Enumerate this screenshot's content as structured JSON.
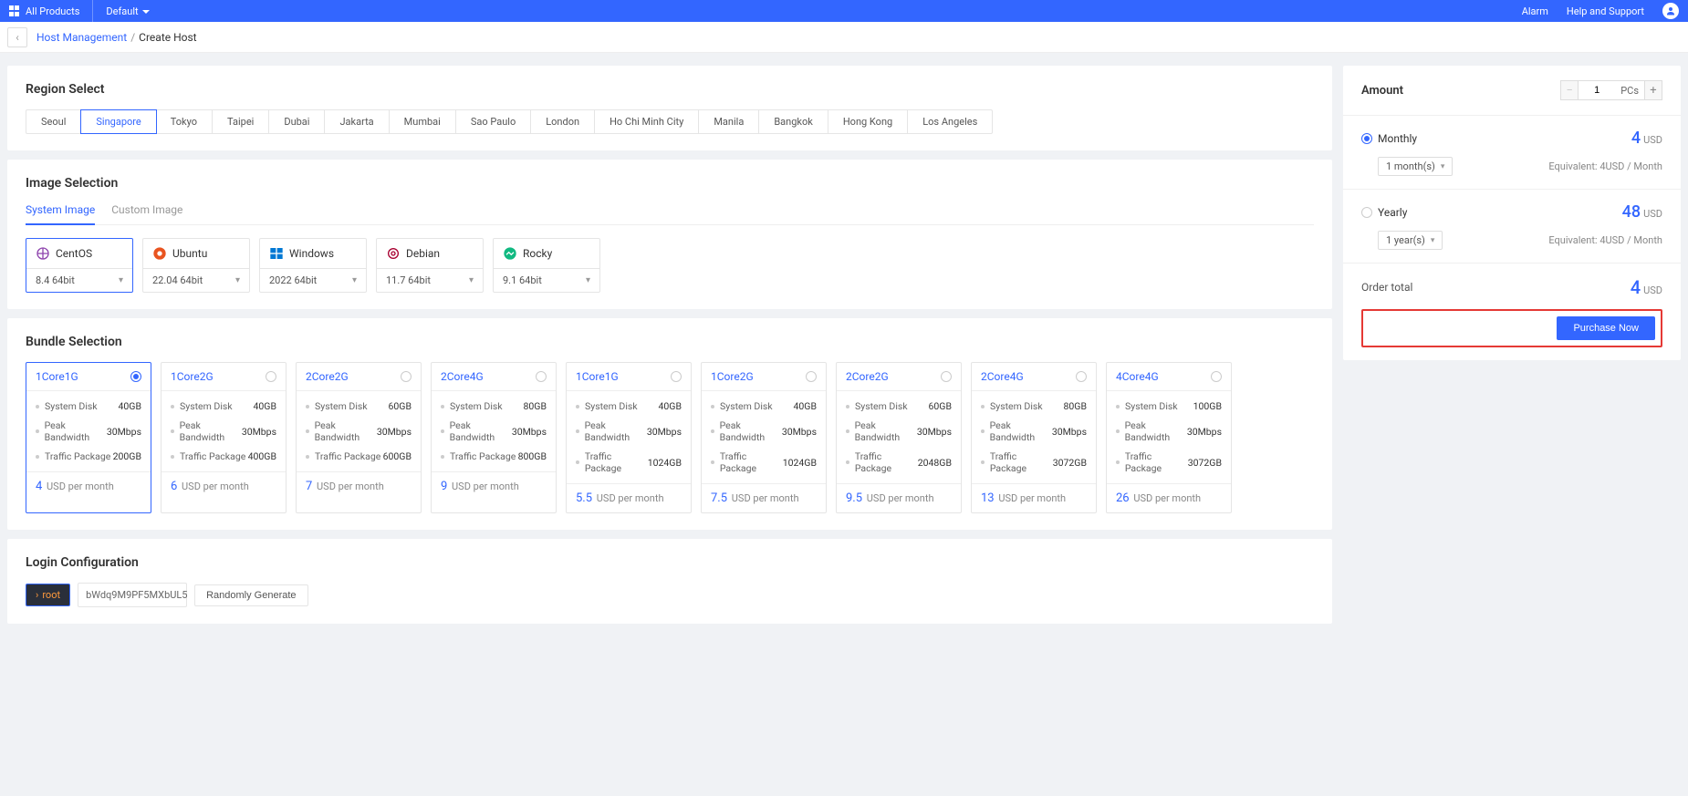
{
  "header": {
    "all_products": "All Products",
    "tenant": "Default",
    "alarm": "Alarm",
    "help": "Help and Support"
  },
  "breadcrumb": {
    "parent": "Host Management",
    "current": "Create Host"
  },
  "region": {
    "title": "Region Select",
    "tabs": [
      "Seoul",
      "Singapore",
      "Tokyo",
      "Taipei",
      "Dubai",
      "Jakarta",
      "Mumbai",
      "Sao Paulo",
      "London",
      "Ho Chi Minh City",
      "Manila",
      "Bangkok",
      "Hong Kong",
      "Los Angeles"
    ],
    "active_index": 1
  },
  "image": {
    "title": "Image Selection",
    "tab_system": "System Image",
    "tab_custom": "Custom Image",
    "os": [
      {
        "name": "CentOS",
        "version": "8.4 64bit",
        "color": "#8e44ad"
      },
      {
        "name": "Ubuntu",
        "version": "22.04 64bit",
        "color": "#e95420"
      },
      {
        "name": "Windows",
        "version": "2022 64bit",
        "color": "#0078d4"
      },
      {
        "name": "Debian",
        "version": "11.7 64bit",
        "color": "#a80030"
      },
      {
        "name": "Rocky",
        "version": "9.1 64bit",
        "color": "#10b981"
      }
    ],
    "active_os": 0
  },
  "bundle": {
    "title": "Bundle Selection",
    "spec_labels": {
      "disk": "System Disk",
      "bw": "Peak Bandwidth",
      "traffic": "Traffic Package"
    },
    "price_suffix": "USD per month",
    "items": [
      {
        "name": "1Core1G",
        "disk": "40GB",
        "bw": "30Mbps",
        "traffic": "200GB",
        "price": "4"
      },
      {
        "name": "1Core2G",
        "disk": "40GB",
        "bw": "30Mbps",
        "traffic": "400GB",
        "price": "6"
      },
      {
        "name": "2Core2G",
        "disk": "60GB",
        "bw": "30Mbps",
        "traffic": "600GB",
        "price": "7"
      },
      {
        "name": "2Core4G",
        "disk": "80GB",
        "bw": "30Mbps",
        "traffic": "800GB",
        "price": "9"
      },
      {
        "name": "1Core1G",
        "disk": "40GB",
        "bw": "30Mbps",
        "traffic": "1024GB",
        "price": "5.5"
      },
      {
        "name": "1Core2G",
        "disk": "40GB",
        "bw": "30Mbps",
        "traffic": "1024GB",
        "price": "7.5"
      },
      {
        "name": "2Core2G",
        "disk": "60GB",
        "bw": "30Mbps",
        "traffic": "2048GB",
        "price": "9.5"
      },
      {
        "name": "2Core4G",
        "disk": "80GB",
        "bw": "30Mbps",
        "traffic": "3072GB",
        "price": "13"
      },
      {
        "name": "4Core4G",
        "disk": "100GB",
        "bw": "30Mbps",
        "traffic": "3072GB",
        "price": "26"
      }
    ],
    "active_index": 0
  },
  "login": {
    "title": "Login Configuration",
    "user": "root",
    "password": "bWdq9M9PF5MXbUL5",
    "random_btn": "Randomly Generate"
  },
  "side": {
    "amount_label": "Amount",
    "amount_value": "1",
    "amount_unit": "PCs",
    "monthly": {
      "label": "Monthly",
      "price": "4",
      "unit": "USD",
      "select": "1 month(s)",
      "equiv": "Equivalent: 4USD / Month"
    },
    "yearly": {
      "label": "Yearly",
      "price": "48",
      "unit": "USD",
      "select": "1 year(s)",
      "equiv": "Equivalent: 4USD / Month"
    },
    "total_label": "Order total",
    "total_price": "4",
    "total_unit": "USD",
    "purchase": "Purchase Now"
  }
}
